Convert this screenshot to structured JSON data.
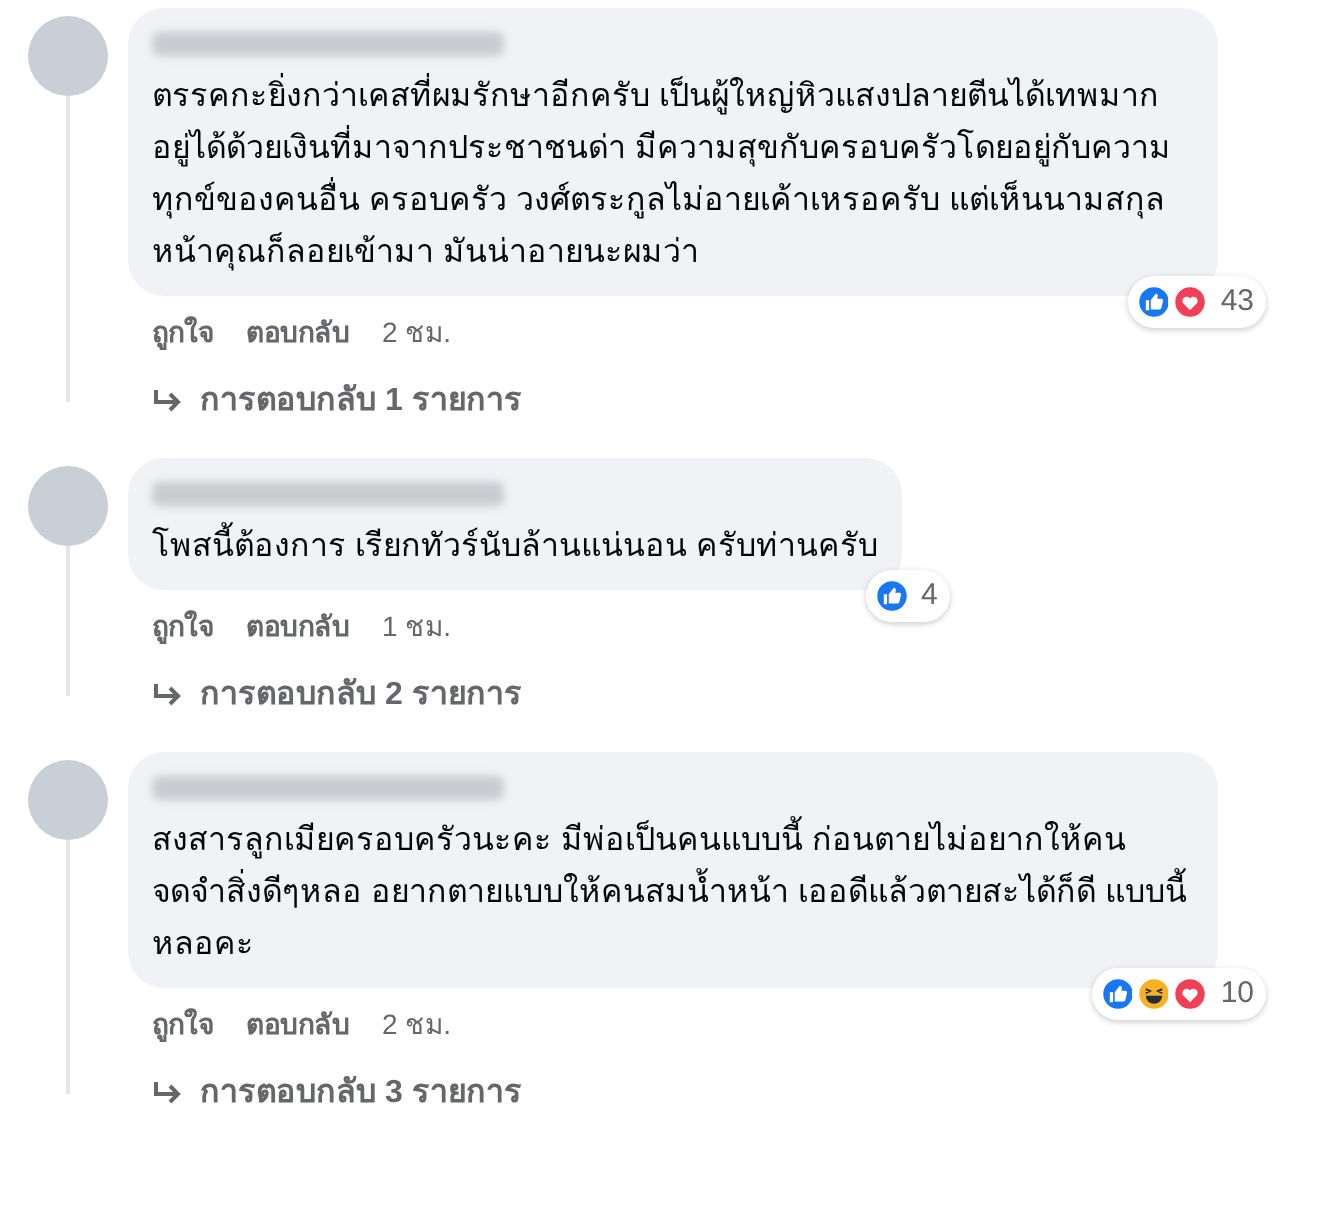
{
  "comments": [
    {
      "text": "ตรรคกะยิ่งกว่าเคสที่ผมรักษาอีกครับ เป็นผู้ใหญ่หิวแสงปลายตีนได้เทพมาก อยู่ได้ด้วยเงินที่มาจากประชาชนด่า มีความสุขกับครอบครัวโดยอยู่กับความทุกข์ของคนอื่น ครอบครัว วงศ์ตระกูลไม่อายเค้าเหรอครับ แต่เห็นนามสกุลหน้าคุณก็ลอยเข้ามา มันน่าอายนะผมว่า",
      "reactions": [
        {
          "kind": "like"
        },
        {
          "kind": "love"
        }
      ],
      "reaction_count": "43",
      "like": "ถูกใจ",
      "reply": "ตอบกลับ",
      "time": "2 ชม.",
      "replies_link": "การตอบกลับ 1 รายการ"
    },
    {
      "text": "โพสนี้ต้องการ เรียกทัวร์นับล้านแน่นอน ครับท่านครับ",
      "reactions": [
        {
          "kind": "like"
        }
      ],
      "reaction_count": "4",
      "like": "ถูกใจ",
      "reply": "ตอบกลับ",
      "time": "1 ชม.",
      "replies_link": "การตอบกลับ 2 รายการ"
    },
    {
      "text": "สงสารลูกเมียครอบครัวนะคะ มีพ่อเป็นคนแบบนี้ ก่อนตายไม่อยากให้คนจดจำสิ่งดีๆหลอ อยากตายแบบให้คนสมน้ำหน้า เออดีแล้วตายสะได้ก็ดี แบบนี้หลอคะ",
      "reactions": [
        {
          "kind": "like"
        },
        {
          "kind": "haha"
        },
        {
          "kind": "love"
        }
      ],
      "reaction_count": "10",
      "like": "ถูกใจ",
      "reply": "ตอบกลับ",
      "time": "2 ชม.",
      "replies_link": "การตอบกลับ 3 รายการ"
    }
  ]
}
